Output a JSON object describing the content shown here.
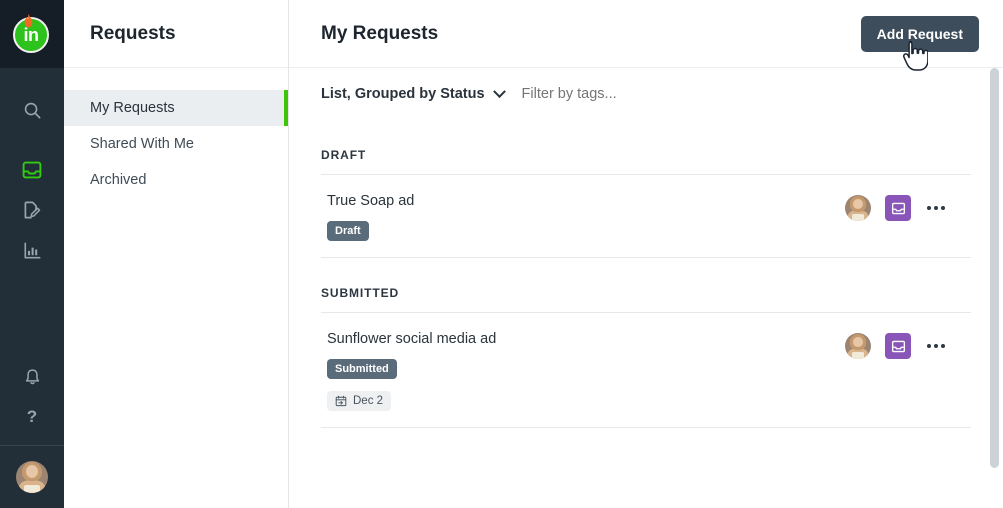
{
  "app": {
    "logo_text": "in",
    "logo_icon": "flame-icon",
    "brand_green": "#2ec21c",
    "rail_bg": "#222e38",
    "accent_green": "#3fc408"
  },
  "rail": {
    "items": [
      {
        "name": "search-icon",
        "label": "Search",
        "active": false
      },
      {
        "name": "inbox-icon",
        "label": "Requests",
        "active": true
      },
      {
        "name": "document-edit-icon",
        "label": "Documents",
        "active": false
      },
      {
        "name": "bar-chart-icon",
        "label": "Reports",
        "active": false
      }
    ],
    "bottom_items": [
      {
        "name": "bell-icon",
        "label": "Notifications"
      },
      {
        "name": "help-icon",
        "label": "Help",
        "glyph": "?"
      }
    ],
    "avatar": "user-avatar"
  },
  "panel": {
    "title": "Requests",
    "items": [
      {
        "label": "My Requests",
        "active": true
      },
      {
        "label": "Shared With Me",
        "active": false
      },
      {
        "label": "Archived",
        "active": false
      }
    ]
  },
  "main": {
    "title": "My Requests",
    "add_button": "Add Request",
    "toolbar": {
      "sort_label": "List, Grouped by Status",
      "sort_icon": "chevron-down-icon",
      "tag_filter_placeholder": "Filter by tags...",
      "tag_filter_value": ""
    },
    "groups": [
      {
        "label": "DRAFT",
        "rows": [
          {
            "title": "True Soap ad",
            "status_chip": "Draft",
            "date_chip": null,
            "date_icon": null,
            "avatar": "user-avatar",
            "action_icon": "inbox-icon",
            "action_color": "#8a55b8",
            "more_icon": "more-options-icon"
          }
        ]
      },
      {
        "label": "SUBMITTED",
        "rows": [
          {
            "title": "Sunflower social media ad",
            "status_chip": "Submitted",
            "date_chip": "Dec 2",
            "date_icon": "calendar-icon",
            "avatar": "user-avatar",
            "action_icon": "inbox-icon",
            "action_color": "#8a55b8",
            "more_icon": "more-options-icon"
          }
        ]
      }
    ]
  },
  "cursor": {
    "type": "pointing-hand-cursor"
  }
}
